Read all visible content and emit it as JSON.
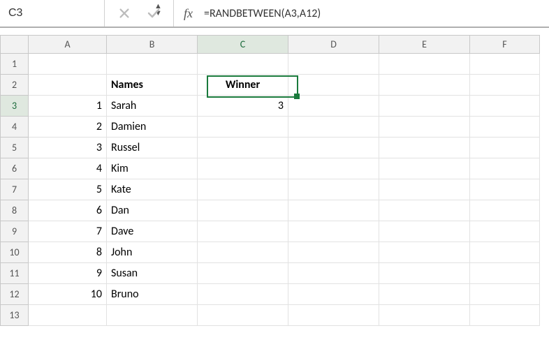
{
  "formula_bar": {
    "cell_ref": "C3",
    "fx_label": "fx",
    "formula": "=RANDBETWEEN(A3,A12)"
  },
  "columns": [
    "A",
    "B",
    "C",
    "D",
    "E",
    "F"
  ],
  "active_column": "C",
  "active_row": "3",
  "rows": [
    {
      "n": "1",
      "A": "",
      "B": "",
      "C": "",
      "D": "",
      "E": "",
      "F": ""
    },
    {
      "n": "2",
      "A": "",
      "B": "Names",
      "C": "Winner",
      "D": "",
      "E": "",
      "F": ""
    },
    {
      "n": "3",
      "A": "1",
      "B": "Sarah",
      "C": "3",
      "D": "",
      "E": "",
      "F": ""
    },
    {
      "n": "4",
      "A": "2",
      "B": "Damien",
      "C": "",
      "D": "",
      "E": "",
      "F": ""
    },
    {
      "n": "5",
      "A": "3",
      "B": "Russel",
      "C": "",
      "D": "",
      "E": "",
      "F": ""
    },
    {
      "n": "6",
      "A": "4",
      "B": "Kim",
      "C": "",
      "D": "",
      "E": "",
      "F": ""
    },
    {
      "n": "7",
      "A": "5",
      "B": "Kate",
      "C": "",
      "D": "",
      "E": "",
      "F": ""
    },
    {
      "n": "8",
      "A": "6",
      "B": "Dan",
      "C": "",
      "D": "",
      "E": "",
      "F": ""
    },
    {
      "n": "9",
      "A": "7",
      "B": "Dave",
      "C": "",
      "D": "",
      "E": "",
      "F": ""
    },
    {
      "n": "10",
      "A": "8",
      "B": "John",
      "C": "",
      "D": "",
      "E": "",
      "F": ""
    },
    {
      "n": "11",
      "A": "9",
      "B": "Susan",
      "C": "",
      "D": "",
      "E": "",
      "F": ""
    },
    {
      "n": "12",
      "A": "10",
      "B": "Bruno",
      "C": "",
      "D": "",
      "E": "",
      "F": ""
    },
    {
      "n": "13",
      "A": "",
      "B": "",
      "C": "",
      "D": "",
      "E": "",
      "F": ""
    }
  ]
}
